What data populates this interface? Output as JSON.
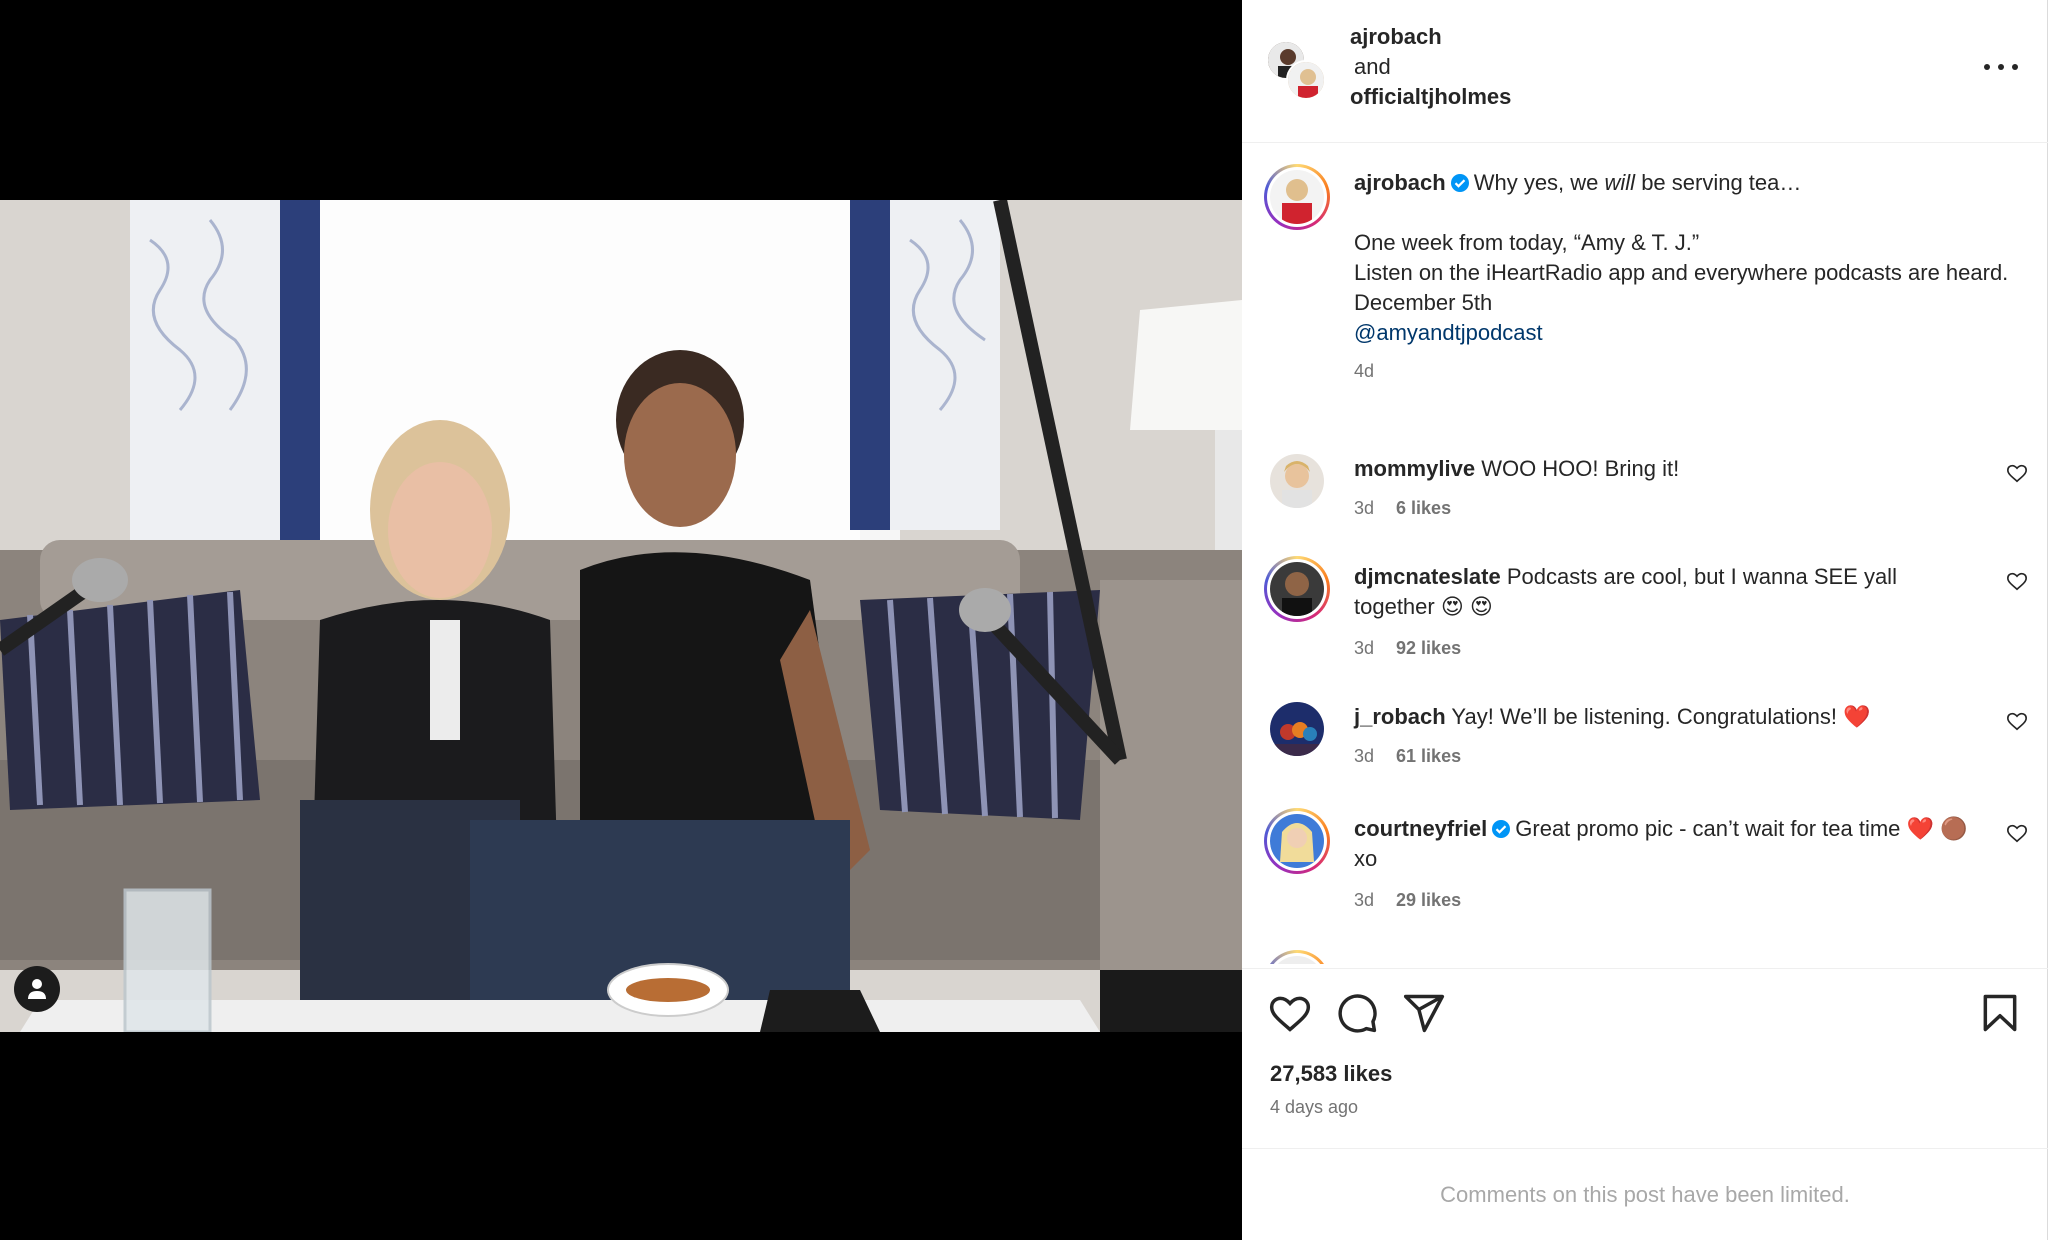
{
  "header": {
    "user1": "ajrobach",
    "and": "and",
    "user2": "officialtjholmes"
  },
  "caption": {
    "user": "ajrobach",
    "line1_pre": "Why yes, we ",
    "line1_em": "will",
    "line1_post": " be serving tea…",
    "line2": "One week from today, “Amy & T. J.”",
    "line3": "Listen on the iHeartRadio app and everywhere podcasts are heard.",
    "line4": "December 5th",
    "mention": "@amyandtjpodcast",
    "age": "4d"
  },
  "comments": [
    {
      "user": "mommylive",
      "text": "WOO HOO! Bring it!",
      "age": "3d",
      "likes": "6 likes"
    },
    {
      "user": "djmcnateslate",
      "text": "Podcasts are cool, but I wanna SEE yall together 😍 😍",
      "age": "3d",
      "likes": "92 likes"
    },
    {
      "user": "j_robach",
      "text": "Yay! We’ll be listening. Congratulations! ❤️",
      "age": "3d",
      "likes": "61 likes"
    },
    {
      "user": "courtneyfriel",
      "text": "Great promo pic - can’t wait for tea time ❤️ 🟤 xo",
      "age": "3d",
      "likes": "29 likes"
    }
  ],
  "footer": {
    "likes": "27,583 likes",
    "ago": "4 days ago",
    "limited": "Comments on this post have been limited."
  },
  "icons": {
    "like": "heart-icon",
    "comment": "comment-icon",
    "share": "share-icon",
    "save": "bookmark-icon",
    "tag": "user-tag-icon",
    "more": "more-options-icon",
    "verified": "verified-badge-icon"
  },
  "colors": {
    "link": "#00376b",
    "verified": "#0095f6",
    "muted": "#737373",
    "heart": "#ed4956"
  }
}
